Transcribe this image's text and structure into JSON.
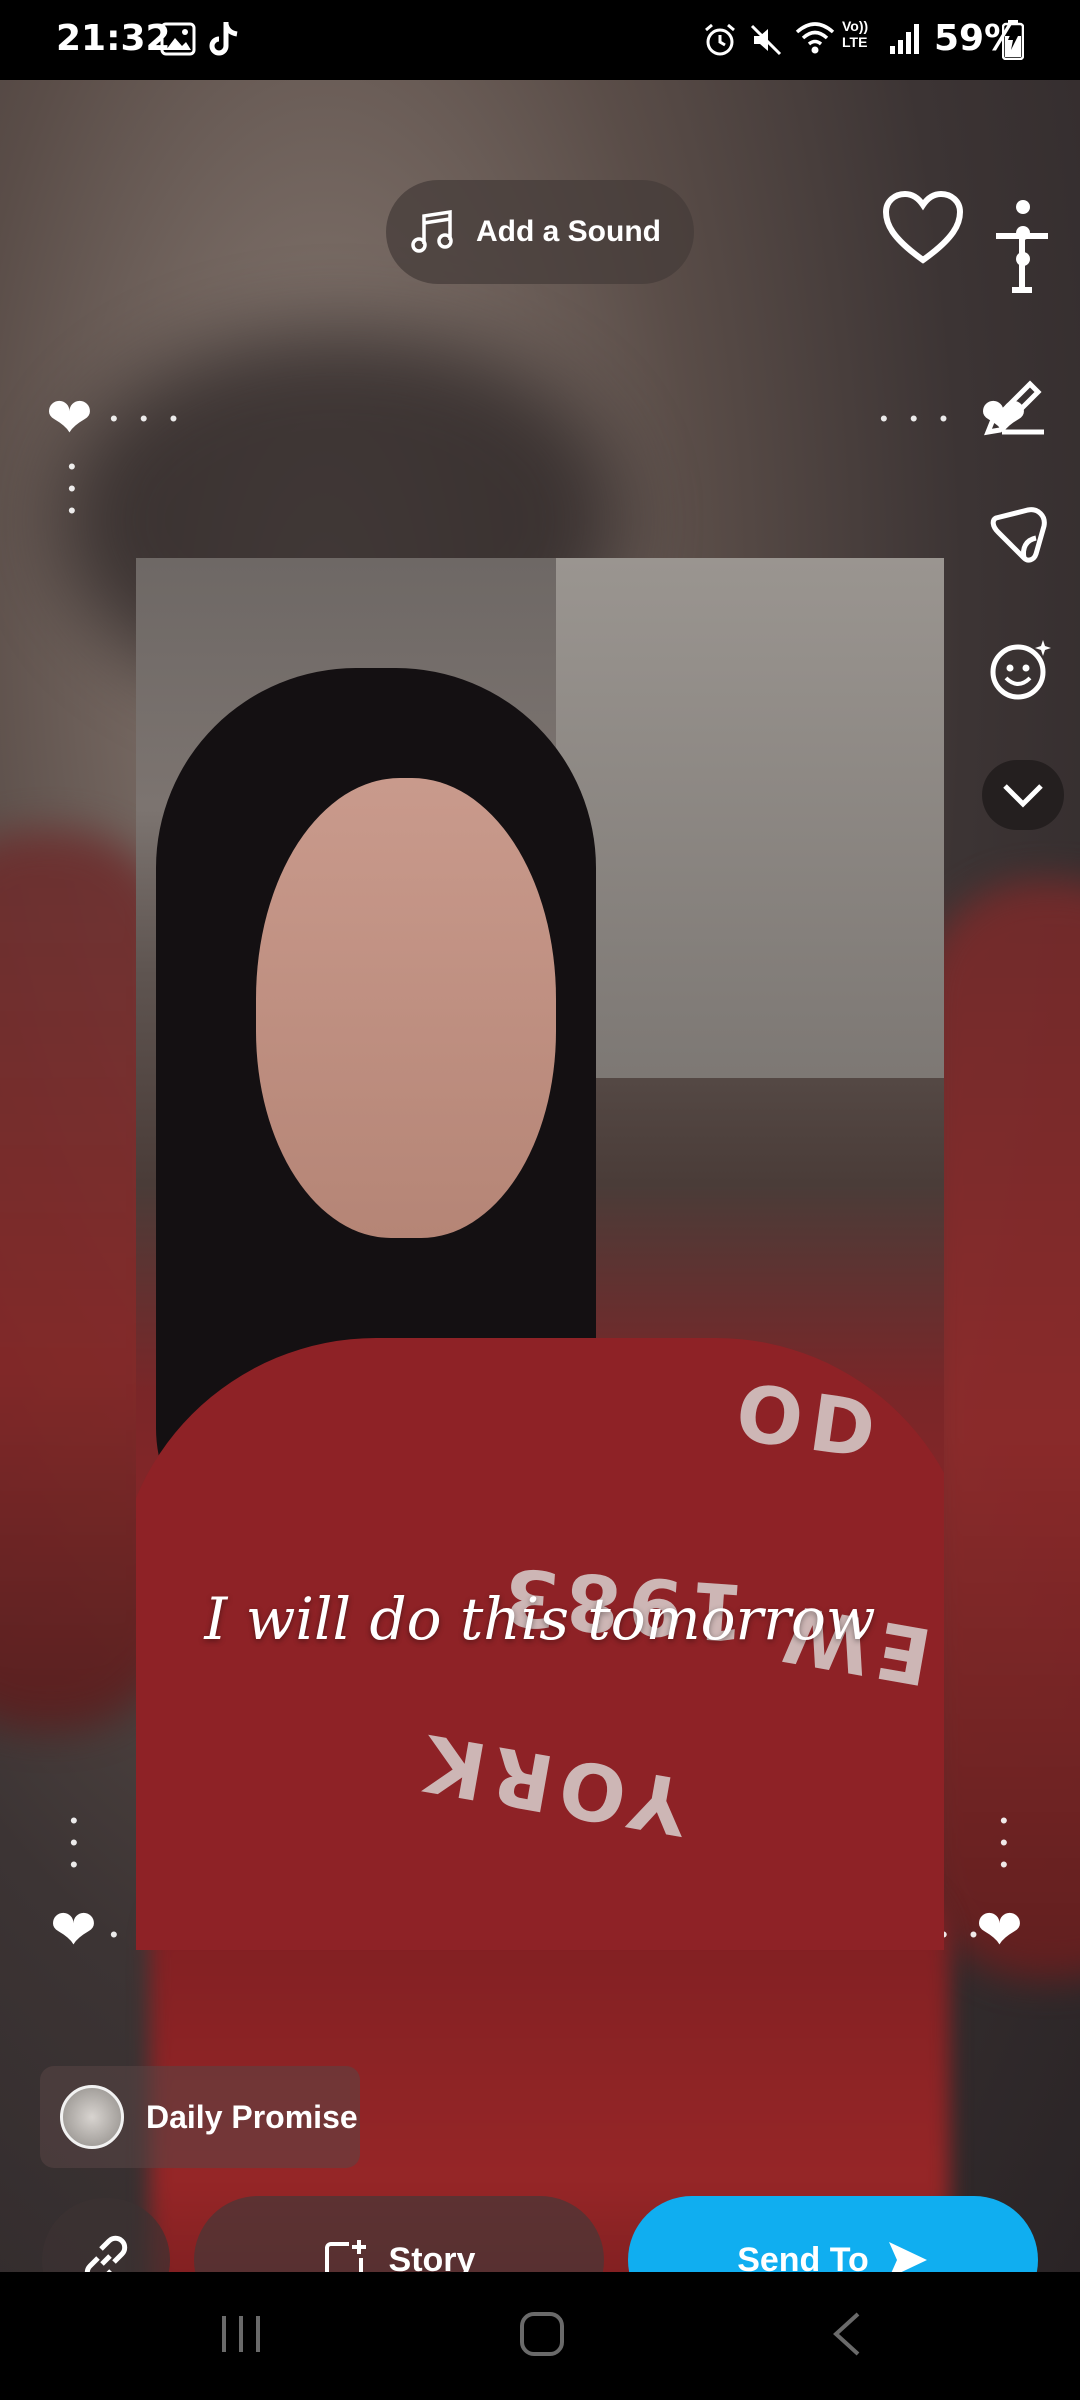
{
  "status_bar": {
    "time": "21:32",
    "battery_percent": "59%",
    "lte_label_top": "Vo))",
    "lte_label_bottom": "LTE"
  },
  "top": {
    "add_sound_label": "Add a Sound"
  },
  "right_toolbar": {
    "tools": [
      "text-tool",
      "pen-tool",
      "sticker-tool",
      "emoji-lens-tool",
      "expand-tools"
    ]
  },
  "snap": {
    "caption": "I will do this tomorrow",
    "shirt_text": [
      "OD",
      "1983",
      "EW",
      "YORK"
    ]
  },
  "bottom": {
    "chip_label": "Daily Promise",
    "story_label": "Story",
    "send_label": "Send To"
  },
  "colors": {
    "send_button": "#10aef0",
    "accent_white": "#ffffff"
  }
}
